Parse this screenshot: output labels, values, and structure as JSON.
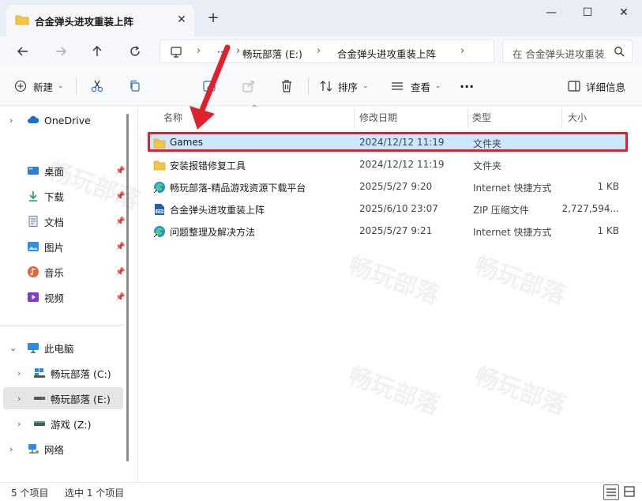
{
  "window": {
    "tab_title": "合金弹头进攻重装上阵",
    "tab_close": "✕",
    "new_tab": "+",
    "minimize": "—",
    "maximize": "☐",
    "close": "✕"
  },
  "address": {
    "ellipsis": "···",
    "crumbs": [
      "畅玩部落 (E:)",
      "合金弹头进攻重装上阵"
    ],
    "search_placeholder": "在 合金弹头进攻重装上阵 中搜索"
  },
  "toolbar": {
    "new_label": "新建",
    "sort_label": "排序",
    "view_label": "查看",
    "more_label": "···",
    "details_label": "详细信息"
  },
  "sidebar": {
    "onedrive": "OneDrive",
    "quick": [
      {
        "label": "桌面",
        "icon": "desktop-icon",
        "color": "#2a7fd4"
      },
      {
        "label": "下载",
        "icon": "download-icon",
        "color": "#1f9e5a"
      },
      {
        "label": "文档",
        "icon": "document-icon",
        "color": "#6b7c93"
      },
      {
        "label": "图片",
        "icon": "picture-icon",
        "color": "#2f8fe0"
      },
      {
        "label": "音乐",
        "icon": "music-icon",
        "color": "#e0673a"
      },
      {
        "label": "视频",
        "icon": "video-icon",
        "color": "#7a3fc4"
      }
    ],
    "this_pc": "此电脑",
    "drives": [
      {
        "label": "畅玩部落 (C:)",
        "icon": "windows-drive-icon"
      },
      {
        "label": "畅玩部落 (E:)",
        "icon": "drive-icon"
      },
      {
        "label": "游戏 (Z:)",
        "icon": "drive-icon"
      }
    ],
    "network": "网络"
  },
  "columns": {
    "name": "名称",
    "date": "修改日期",
    "type": "类型",
    "size": "大小"
  },
  "files": [
    {
      "name": "Games",
      "date": "2024/12/12 11:19",
      "type": "文件夹",
      "size": "",
      "icon": "folder-icon"
    },
    {
      "name": "安装报错修复工具",
      "date": "2024/12/12 11:19",
      "type": "文件夹",
      "size": "",
      "icon": "folder-icon"
    },
    {
      "name": "畅玩部落-精品游戏资源下载平台",
      "date": "2025/5/27 9:20",
      "type": "Internet 快捷方式",
      "size": "1 KB",
      "icon": "edge-shortcut-icon"
    },
    {
      "name": "合金弹头进攻重装上阵",
      "date": "2025/6/10 23:07",
      "type": "ZIP 压缩文件",
      "size": "2,727,594...",
      "icon": "zip-icon"
    },
    {
      "name": "问题整理及解决方法",
      "date": "2025/5/27 9:21",
      "type": "Internet 快捷方式",
      "size": "1 KB",
      "icon": "edge-shortcut-icon"
    }
  ],
  "status": {
    "count": "5 个项目",
    "selected": "选中 1 个项目"
  },
  "watermark_text": "畅玩部落",
  "colors": {
    "accent": "#0067c0",
    "selection": "#cce8ff",
    "highlight_box": "#e0202a",
    "folder": "#f4c542"
  }
}
